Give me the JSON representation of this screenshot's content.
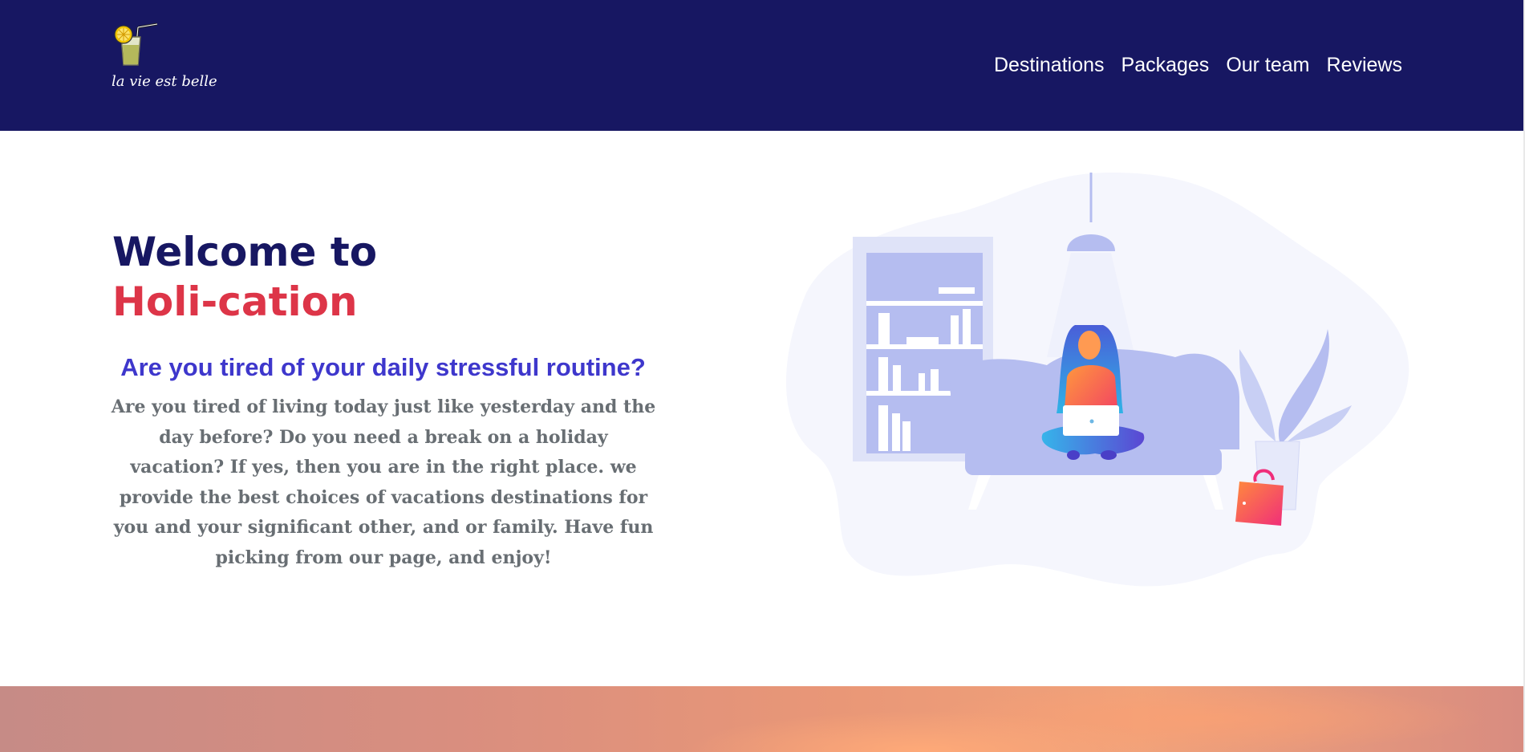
{
  "header": {
    "logo_text": "la vie est belle",
    "logo_icon": "lemonade-glass-icon",
    "background_color": "#171762"
  },
  "nav": {
    "items": [
      {
        "label": "Destinations"
      },
      {
        "label": "Packages"
      },
      {
        "label": "Our team"
      },
      {
        "label": "Reviews"
      }
    ]
  },
  "hero": {
    "title_line1": "Welcome to",
    "title_line2": "Holi-cation",
    "title_color": "#171762",
    "accent_color": "#dd3548",
    "subheading": "Are you tired of your daily stressful routine?",
    "subheading_color": "#3e37cc",
    "body": "Are you tired of living today just like yesterday and the day before? Do you need a break on a holiday vacation? If yes, then you are in the right place. we provide the best choices of vacations destinations for you and your significant other, and or family. Have fun picking from our page, and enjoy!",
    "body_color": "#686e73",
    "illustration_icon": "woman-relaxing-with-laptop-illustration"
  }
}
